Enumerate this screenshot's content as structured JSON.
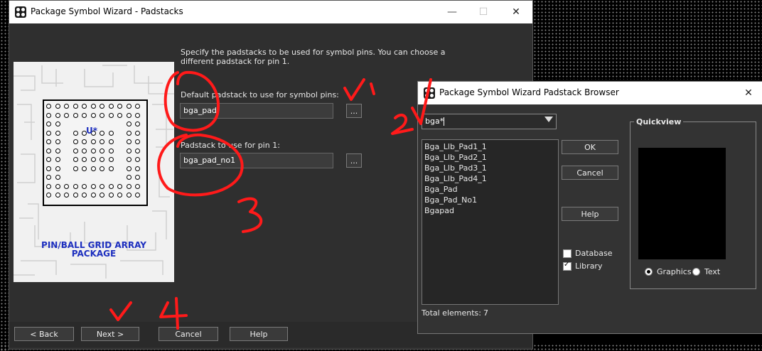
{
  "main_window": {
    "title": "Package Symbol Wizard - Padstacks",
    "minimize": "—",
    "maximize": "☐",
    "close": "✕",
    "instructions": "Specify the padstacks to be used for symbol pins. You can choose a different padstack for pin 1.",
    "default_label": "Default padstack to use for symbol pins:",
    "default_value": "bga_pad",
    "pin1_label": "Padstack to use for pin 1:",
    "pin1_value": "bga_pad_no1",
    "browse_label": "...",
    "preview": {
      "ref": "U*",
      "caption_line1": "PIN/BALL GRID ARRAY",
      "caption_line2": "PACKAGE"
    },
    "buttons": {
      "back": "< Back",
      "next": "Next >",
      "cancel": "Cancel",
      "help": "Help"
    }
  },
  "browser": {
    "title": "Package Symbol Wizard Padstack Browser",
    "close": "✕",
    "filter_value": "bga*",
    "items": [
      "Bga_Llb_Pad1_1",
      "Bga_Llb_Pad2_1",
      "Bga_Llb_Pad3_1",
      "Bga_Llb_Pad4_1",
      "Bga_Pad",
      "Bga_Pad_No1",
      "Bgapad"
    ],
    "ok": "OK",
    "cancel": "Cancel",
    "help": "Help",
    "database_label": "Database",
    "database_checked": false,
    "library_label": "Library",
    "library_checked": true,
    "quickview_label": "Quickview",
    "graphics_label": "Graphics",
    "text_label": "Text",
    "view_mode": "Graphics",
    "total_label": "Total elements:",
    "total_value": "7"
  },
  "annotations": {
    "color": "#ff1a1a",
    "v1": "V1",
    "v2": "2V",
    "n3": "3",
    "v4": "V4"
  }
}
